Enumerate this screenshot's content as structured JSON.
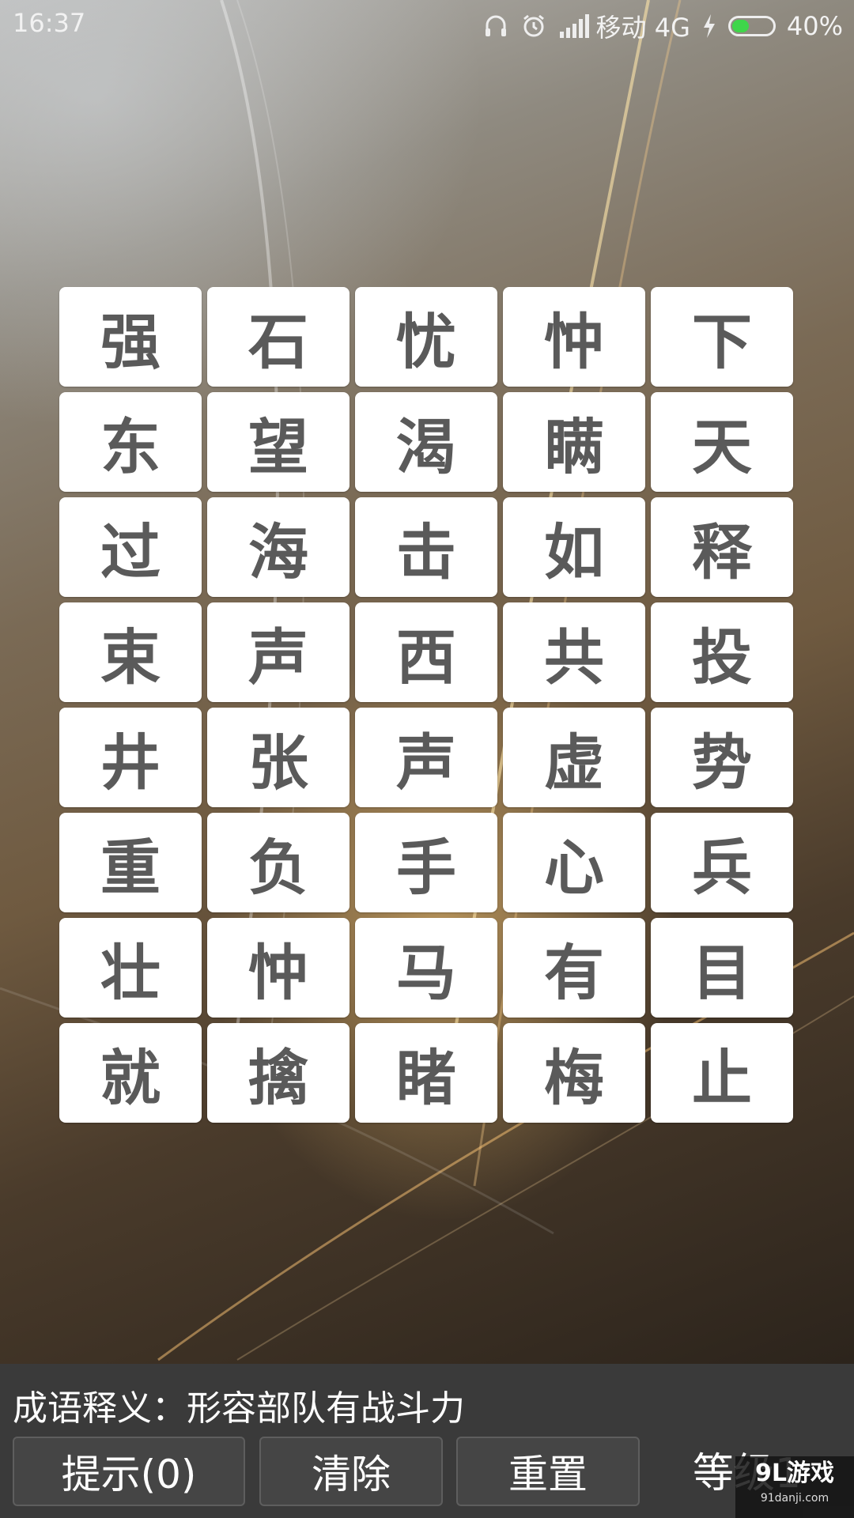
{
  "status_bar": {
    "time": "16:37",
    "carrier": "移动 4G",
    "battery": "40%",
    "battery_level": 0.4,
    "icons": [
      "headset-icon",
      "alarm-icon",
      "signal-icon",
      "charging-icon",
      "battery-icon"
    ],
    "accent_color": "#3fd64a"
  },
  "grid": {
    "rows": [
      [
        "强",
        "石",
        "忧",
        "忡",
        "下"
      ],
      [
        "东",
        "望",
        "渴",
        "瞒",
        "天"
      ],
      [
        "过",
        "海",
        "击",
        "如",
        "释"
      ],
      [
        "束",
        "声",
        "西",
        "共",
        "投"
      ],
      [
        "井",
        "张",
        "声",
        "虚",
        "势"
      ],
      [
        "重",
        "负",
        "手",
        "心",
        "兵"
      ],
      [
        "壮",
        "忡",
        "马",
        "有",
        "目"
      ],
      [
        "就",
        "擒",
        "睹",
        "梅",
        "止"
      ]
    ]
  },
  "panel": {
    "meaning": "成语释义：形容部队有战斗力",
    "hint_button": "提示(0)",
    "clear_button": "清除",
    "reset_button": "重置",
    "level": "等级1"
  },
  "watermark": {
    "logo": "9L游戏",
    "url": "91danji.com"
  }
}
